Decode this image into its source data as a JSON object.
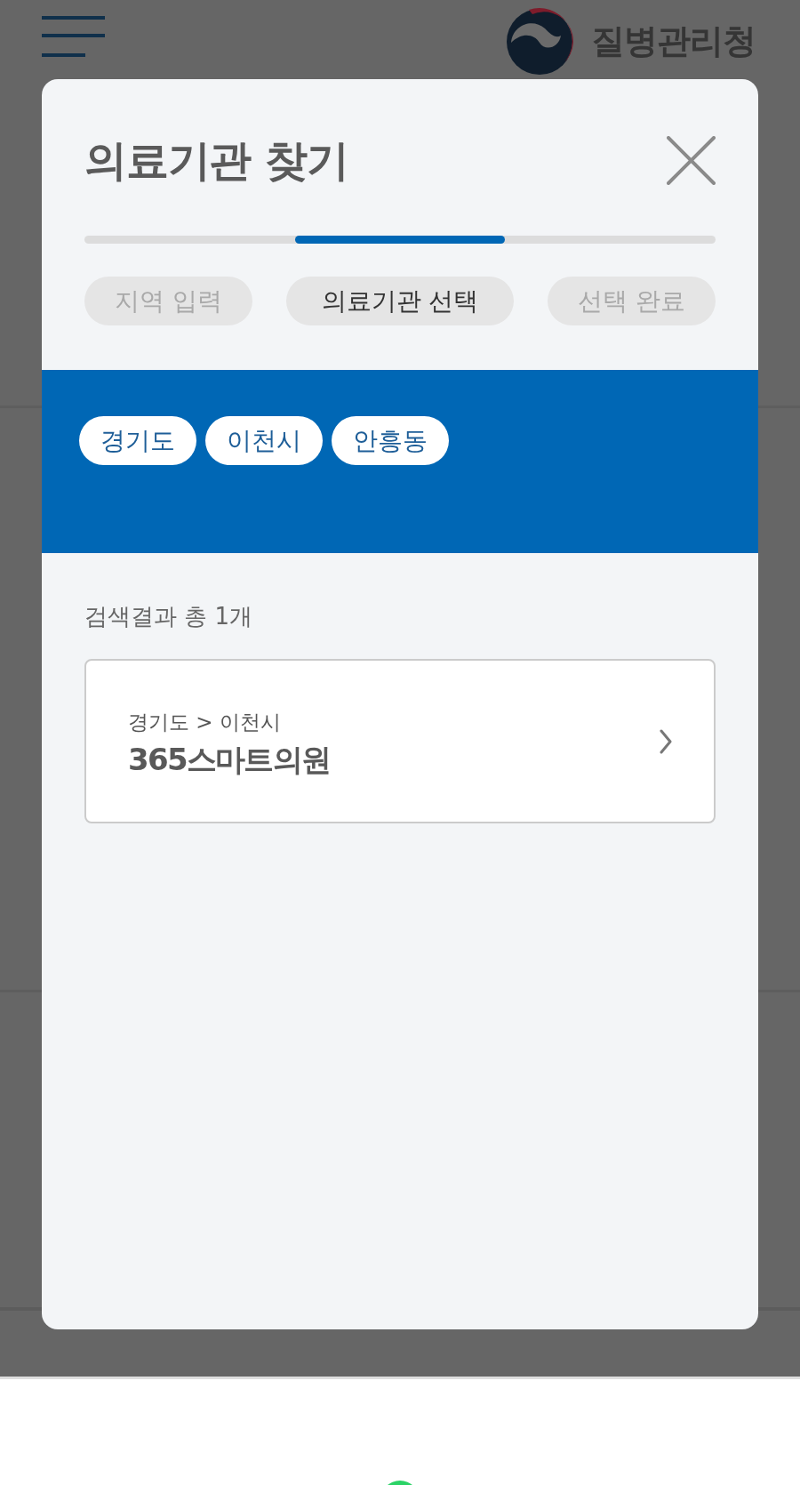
{
  "header": {
    "logo_text": "질병관리청"
  },
  "modal": {
    "title": "의료기관 찾기",
    "steps": [
      {
        "label": "지역 입력",
        "selected": false
      },
      {
        "label": "의료기관 선택",
        "selected": true
      },
      {
        "label": "선택 완료",
        "selected": false
      }
    ],
    "region_chips": [
      "경기도",
      "이천시",
      "안흥동"
    ],
    "result_count": "검색결과 총 1개",
    "results": [
      {
        "path": "경기도 > 이천시",
        "name": "365스마트의원"
      }
    ]
  }
}
